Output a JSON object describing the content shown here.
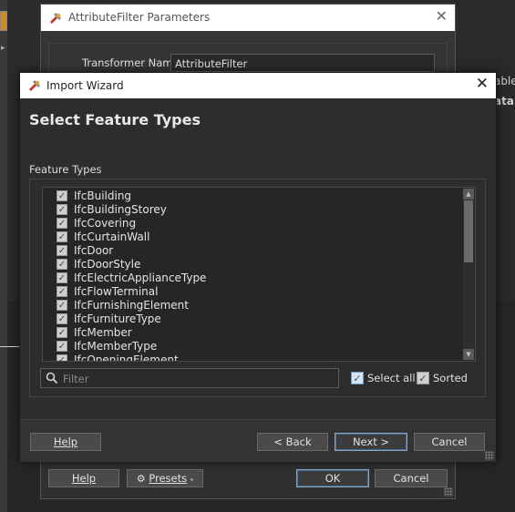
{
  "background": {
    "text_line_1": "able",
    "text_line_2": "ata"
  },
  "back_dialog": {
    "title": "AttributeFilter Parameters",
    "transformer_name_label": "Transformer Name:",
    "transformer_name_value": "AttributeFilter",
    "buttons": {
      "help": "Help",
      "presets": "Presets",
      "ok": "OK",
      "cancel": "Cancel"
    }
  },
  "wizard": {
    "title": "Import Wizard",
    "heading": "Select Feature Types",
    "feature_types_label": "Feature Types",
    "feature_types": [
      {
        "name": "IfcBuilding",
        "checked": true
      },
      {
        "name": "IfcBuildingStorey",
        "checked": true
      },
      {
        "name": "IfcCovering",
        "checked": true
      },
      {
        "name": "IfcCurtainWall",
        "checked": true
      },
      {
        "name": "IfcDoor",
        "checked": true
      },
      {
        "name": "IfcDoorStyle",
        "checked": true
      },
      {
        "name": "IfcElectricApplianceType",
        "checked": true
      },
      {
        "name": "IfcFlowTerminal",
        "checked": true
      },
      {
        "name": "IfcFurnishingElement",
        "checked": true
      },
      {
        "name": "IfcFurnitureType",
        "checked": true
      },
      {
        "name": "IfcMember",
        "checked": true
      },
      {
        "name": "IfcMemberType",
        "checked": true
      },
      {
        "name": "IfcOpeningElement",
        "checked": true
      }
    ],
    "filter_placeholder": "Filter",
    "select_all_label": "Select all",
    "select_all_checked": true,
    "sorted_label": "Sorted",
    "sorted_checked": true,
    "buttons": {
      "help": "Help",
      "back": "< Back",
      "next": "Next >",
      "cancel": "Cancel"
    }
  },
  "colors": {
    "accent_border": "#8aa7c8",
    "checkbox_blue": "#6a9ad0"
  }
}
